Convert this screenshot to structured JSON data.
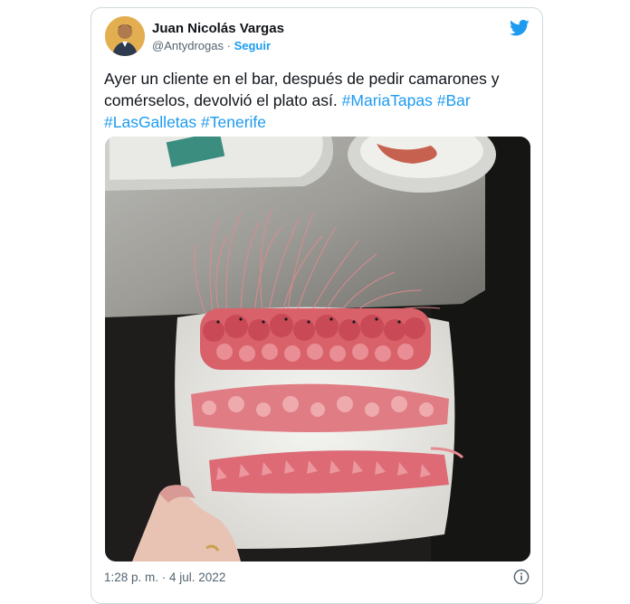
{
  "author": {
    "name": "Juan Nicolás Vargas",
    "handle": "@Antydrogas",
    "separator": "·",
    "follow_label": "Seguir",
    "avatar_icon": "user-avatar"
  },
  "platform_icon": "twitter-bird-icon",
  "tweet": {
    "text_part1": "Ayer un cliente en el bar, después de pedir camarones y comérselos, devolvió el plato así.",
    "hashtags": [
      "#MariaTapas",
      "#Bar",
      "#LasGalletas",
      "#Tenerife"
    ]
  },
  "media": {
    "icon": "photo-shrimp-plate"
  },
  "footer": {
    "timestamp": "1:28 p. m. · 4 jul. 2022",
    "info_icon": "info-icon"
  },
  "colors": {
    "accent": "#1d9bf0",
    "text": "#0f1419",
    "muted": "#536471",
    "border": "#cfd9de"
  }
}
